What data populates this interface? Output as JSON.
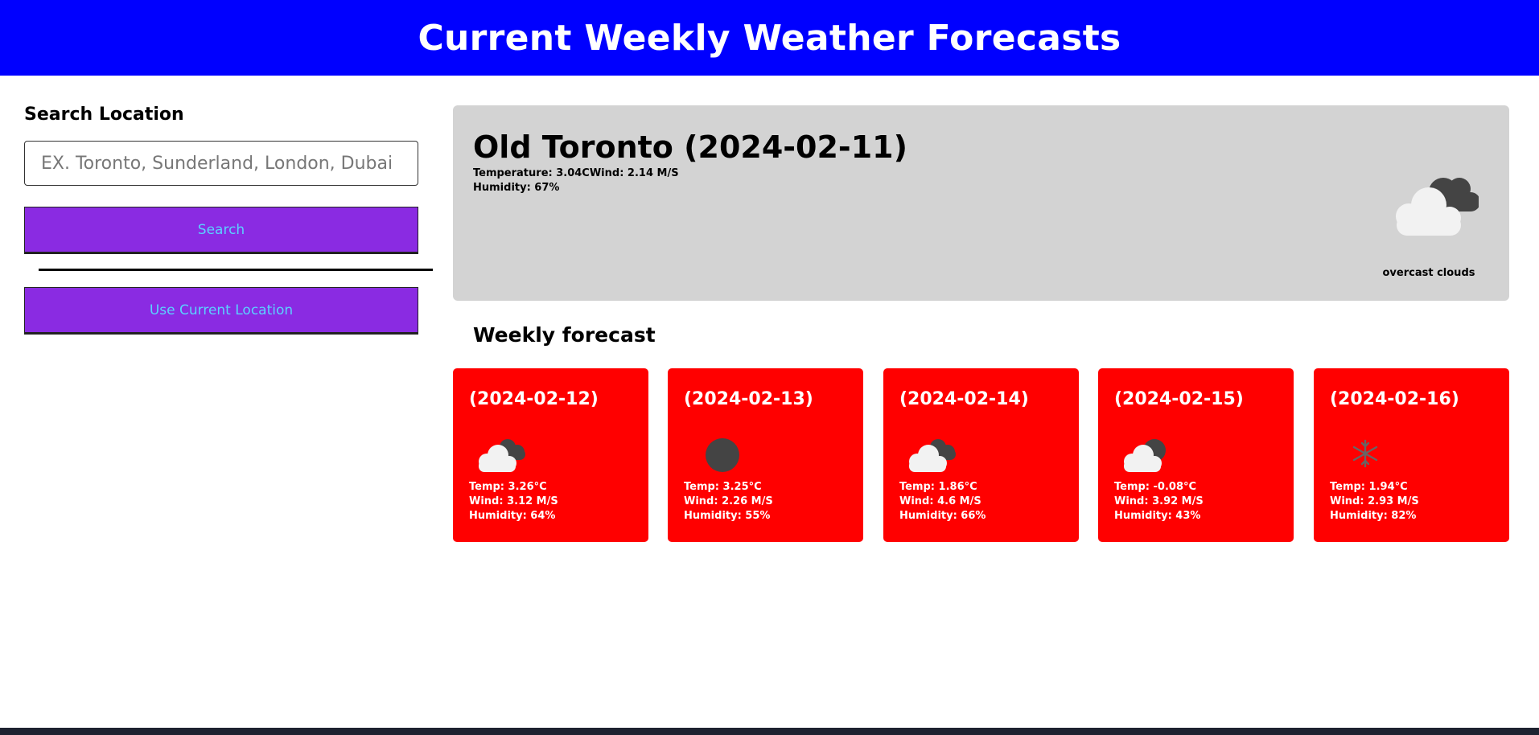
{
  "header": {
    "title": "Current Weekly Weather Forecasts"
  },
  "sidebar": {
    "heading": "Search Location",
    "search_placeholder": "EX. Toronto, Sunderland, London, Dubai",
    "search_button": "Search",
    "current_location_button": "Use Current Location"
  },
  "current": {
    "title": "Old Toronto (2024-02-11)",
    "temperature_wind": "Temperature: 3.04CWind: 2.14 M/S",
    "humidity": "Humidity: 67%",
    "description": "overcast clouds",
    "icon": "overcast-clouds-icon"
  },
  "weekly": {
    "heading": "Weekly forecast",
    "days": [
      {
        "date": "(2024-02-12)",
        "icon": "broken-clouds-icon",
        "temp": "Temp: 3.26°C",
        "wind": "Wind: 3.12 M/S",
        "humidity": "Humidity: 64%"
      },
      {
        "date": "(2024-02-13)",
        "icon": "dark-cloud-icon",
        "temp": "Temp: 3.25°C",
        "wind": "Wind: 2.26 M/S",
        "humidity": "Humidity: 55%"
      },
      {
        "date": "(2024-02-14)",
        "icon": "broken-clouds-icon",
        "temp": "Temp: 1.86°C",
        "wind": "Wind: 4.6 M/S",
        "humidity": "Humidity: 66%"
      },
      {
        "date": "(2024-02-15)",
        "icon": "partly-cloudy-icon",
        "temp": "Temp: -0.08°C",
        "wind": "Wind: 3.92 M/S",
        "humidity": "Humidity: 43%"
      },
      {
        "date": "(2024-02-16)",
        "icon": "snow-icon",
        "temp": "Temp: 1.94°C",
        "wind": "Wind: 2.93 M/S",
        "humidity": "Humidity: 82%"
      }
    ]
  },
  "colors": {
    "header_bg": "#0000ff",
    "button_bg": "#8a2be2",
    "button_text": "#5ad2ff",
    "current_card_bg": "#d3d3d3",
    "forecast_card_bg": "#ff0000"
  }
}
